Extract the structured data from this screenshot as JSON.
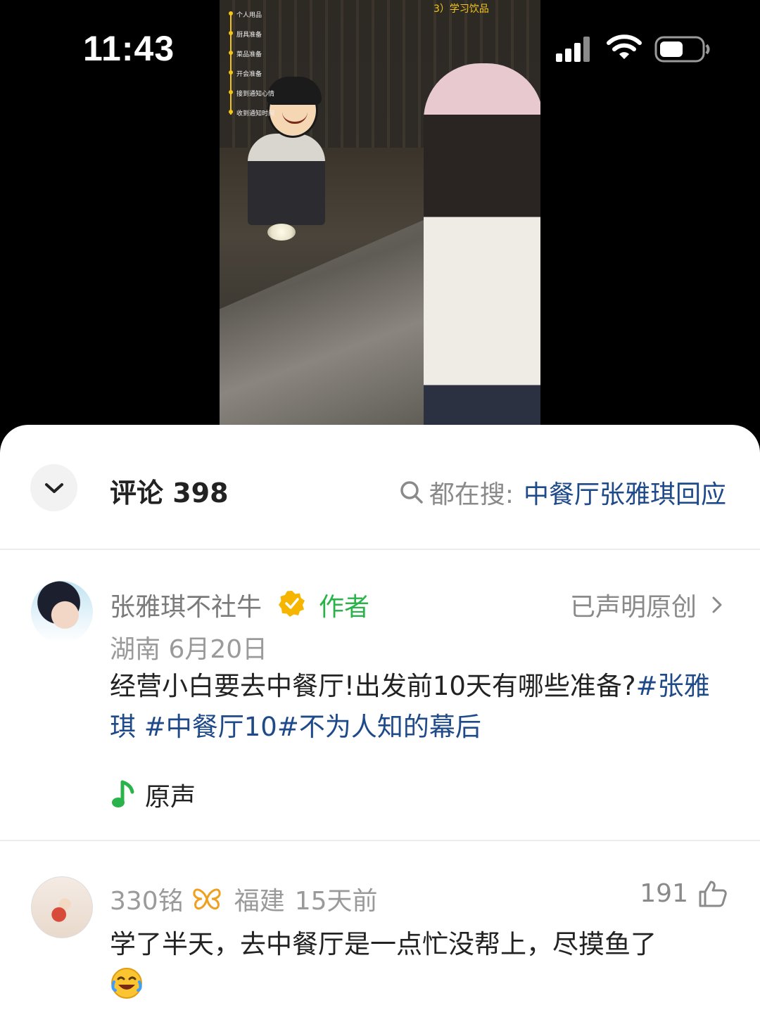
{
  "status_bar": {
    "time": "11:43"
  },
  "video": {
    "step_label": "3）学习饮品",
    "menu_items": [
      "个人用品",
      "厨具准备",
      "菜品准备",
      "开会准备",
      "接到通知心情",
      "收到通知时间"
    ]
  },
  "header": {
    "comment_label": "评论 398",
    "trending_prefix": "都在搜:",
    "trending_term": "中餐厅张雅琪回应"
  },
  "author_post": {
    "name": "张雅琪不社牛",
    "tag": "作者",
    "original_label": "已声明原创",
    "location_date": "湖南 6月20日",
    "text_plain": "经营小白要去中餐厅!出发前10天有哪些准备?",
    "hashtag_1": "#张雅琪",
    "hashtag_2": "#中餐厅10",
    "hashtag_3": "#不为人知的幕后",
    "sound_label": "原声"
  },
  "reply": {
    "username": "330铭",
    "location": "福建",
    "time_ago": "15天前",
    "likes": "191",
    "text": "学了半天，去中餐厅是一点忙没帮上，尽摸鱼了"
  },
  "colors": {
    "link_blue": "#1f4a8a",
    "author_green": "#2bb34b",
    "verified_gold": "#f5b500",
    "badge_orange": "#f0a020"
  },
  "icons": {
    "collapse": "chevron-down-icon",
    "search": "search-icon",
    "verified": "verified-badge-icon",
    "chevron_right": "chevron-right-icon",
    "music_note": "music-note-icon",
    "like": "thumbs-up-icon",
    "emoji": "crying-laughing-emoji-icon"
  }
}
